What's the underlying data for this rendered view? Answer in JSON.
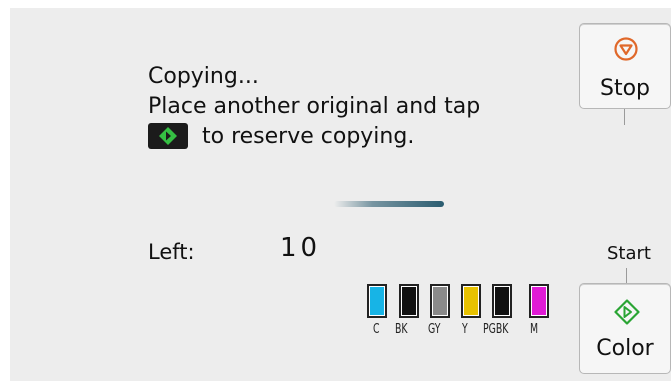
{
  "message": {
    "line1": "Copying...",
    "line2": "Place another original and tap",
    "line3": "to reserve copying.",
    "inline_icon": "start-diamond-icon"
  },
  "progress": {
    "state": "in-progress"
  },
  "remaining": {
    "label": "Left:",
    "value": "10"
  },
  "ink": [
    {
      "label": "C",
      "color": "#17b4e6"
    },
    {
      "label": "BK",
      "color": "#111111"
    },
    {
      "label": "GY",
      "color": "#8a8a8a"
    },
    {
      "label": "Y",
      "color": "#e8c200"
    },
    {
      "label": "PGBK",
      "color": "#111111"
    },
    {
      "label": "M",
      "color": "#e01bd6"
    }
  ],
  "buttons": {
    "stop": {
      "label": "Stop",
      "icon": "stop-icon",
      "accent": "#e0682a"
    },
    "color": {
      "label": "Color",
      "icon": "start-diamond-icon",
      "accent": "#2aa534"
    },
    "start_caption": "Start"
  }
}
